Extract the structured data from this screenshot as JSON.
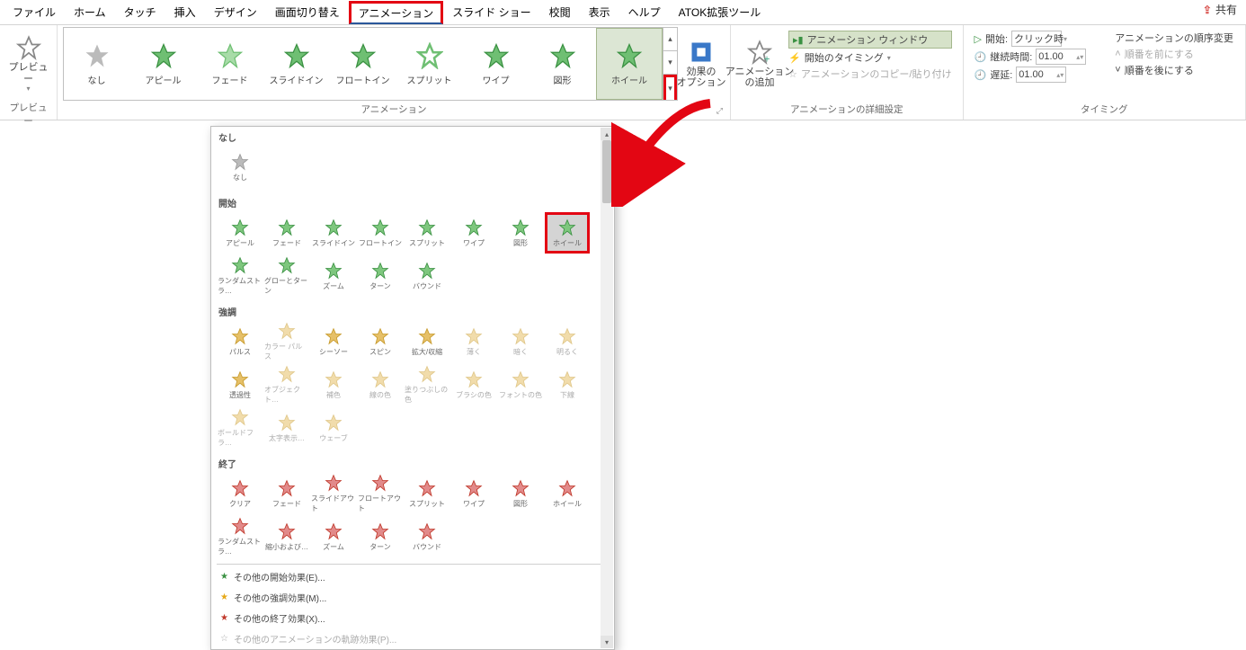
{
  "tabs": [
    "ファイル",
    "ホーム",
    "タッチ",
    "挿入",
    "デザイン",
    "画面切り替え",
    "アニメーション",
    "スライド ショー",
    "校閲",
    "表示",
    "ヘルプ",
    "ATOK拡張ツール"
  ],
  "active_tab": "アニメーション",
  "share": "共有",
  "preview": {
    "label": "プレビュー",
    "group": "プレビュー"
  },
  "gallery": {
    "items": [
      "なし",
      "アピール",
      "フェード",
      "スライドイン",
      "フロートイン",
      "スプリット",
      "ワイプ",
      "図形",
      "ホイール"
    ],
    "selected": "ホイール",
    "group": "アニメーション"
  },
  "effect_options": "効果の\nオプション",
  "add_anim": {
    "label": "アニメーション\nの追加"
  },
  "adv": {
    "pane": "アニメーション ウィンドウ",
    "trigger": "開始のタイミング",
    "painter": "アニメーションのコピー/貼り付け",
    "group": "アニメーションの詳細設定"
  },
  "timing": {
    "start_lbl": "開始:",
    "start_val": "クリック時",
    "dur_lbl": "継続時間:",
    "dur_val": "01.00",
    "delay_lbl": "遅延:",
    "delay_val": "01.00",
    "reorder": "アニメーションの順序変更",
    "earlier": "順番を前にする",
    "later": "順番を後にする",
    "group": "タイミング"
  },
  "panel": {
    "none_hdr": "なし",
    "none": [
      "なし"
    ],
    "start_hdr": "開始",
    "start_items": [
      "アピール",
      "フェード",
      "スライドイン",
      "フロートイン",
      "スプリット",
      "ワイプ",
      "図形",
      "ホイール",
      "ランダムストラ…",
      "グローとターン",
      "ズーム",
      "ターン",
      "バウンド"
    ],
    "start_selected": "ホイール",
    "emph_hdr": "強調",
    "emph": [
      "パルス",
      "カラー パルス",
      "シーソー",
      "スピン",
      "拡大/収縮",
      "薄く",
      "暗く",
      "明るく",
      "透過性",
      "オブジェクト…",
      "補色",
      "線の色",
      "塗りつぶしの色",
      "ブラシの色",
      "フォントの色",
      "下線",
      "ボールドフラ…",
      "太字表示…",
      "ウェーブ"
    ],
    "exit_hdr": "終了",
    "exit": [
      "クリア",
      "フェード",
      "スライドアウト",
      "フロートアウト",
      "スプリット",
      "ワイプ",
      "図形",
      "ホイール",
      "ランダムストラ…",
      "縮小および…",
      "ズーム",
      "ターン",
      "バウンド"
    ],
    "more_entrance": "その他の開始効果(E)...",
    "more_emphasis": "その他の強調効果(M)...",
    "more_exit": "その他の終了効果(X)...",
    "more_motion": "その他のアニメーションの軌跡効果(P)..."
  }
}
